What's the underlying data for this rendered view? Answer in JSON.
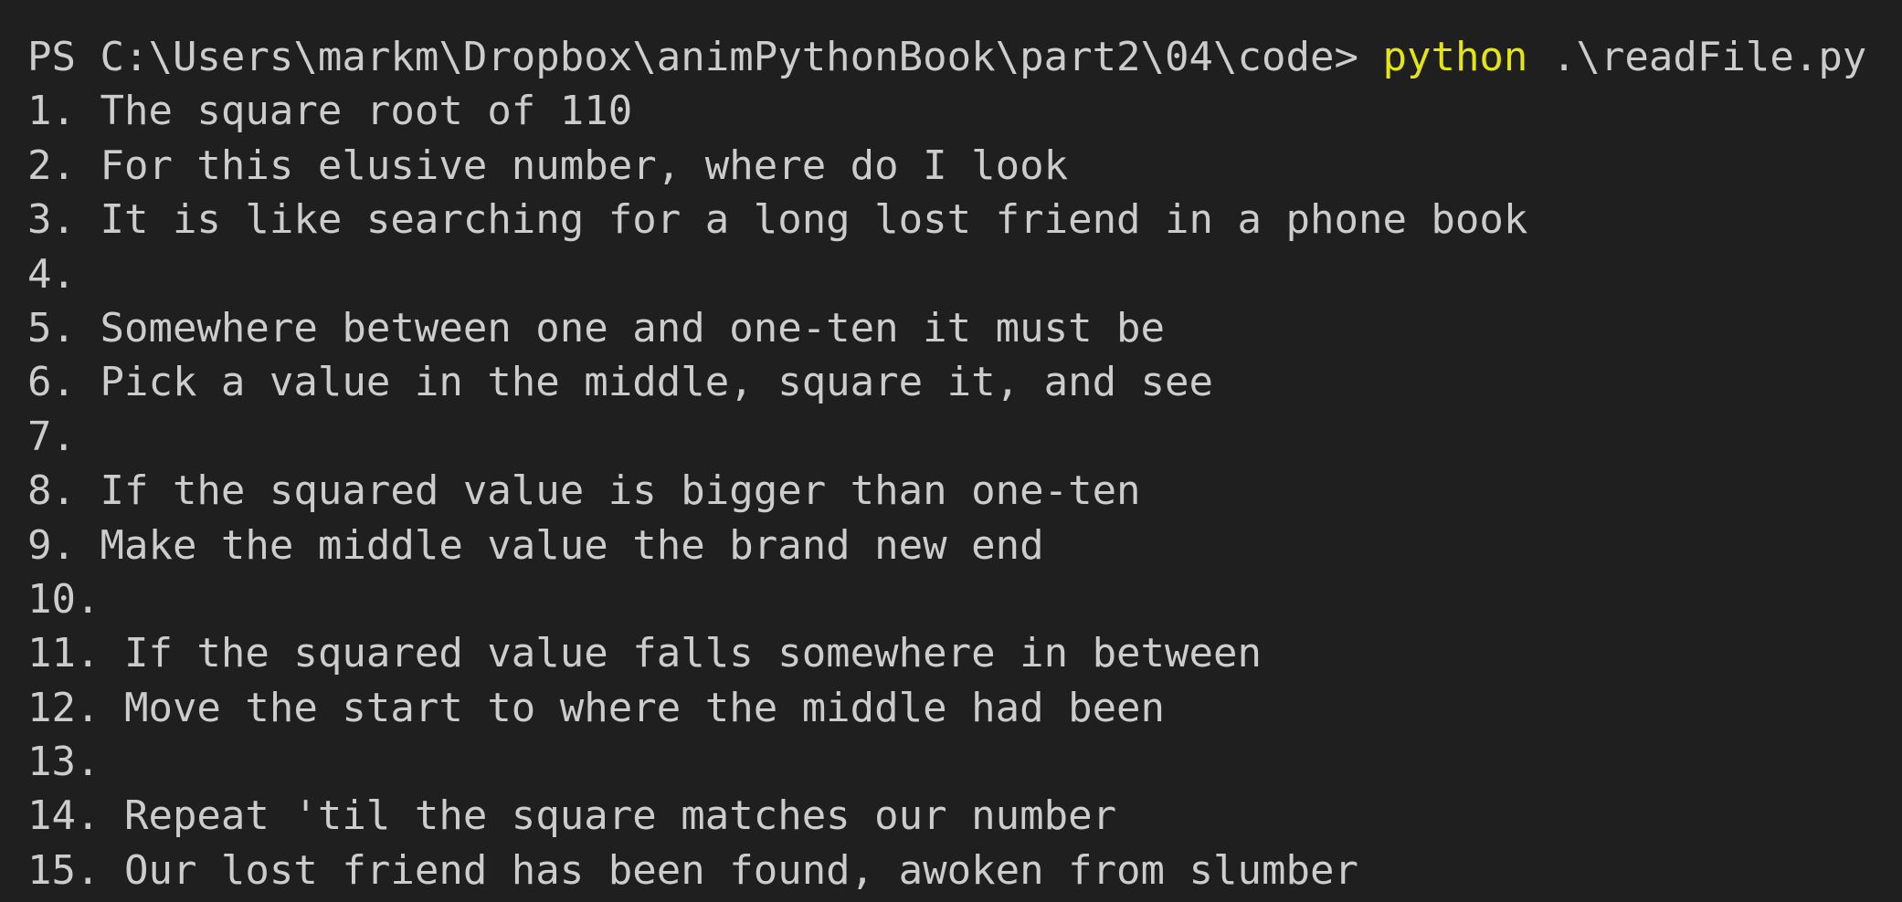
{
  "terminal": {
    "prompt": "PS C:\\Users\\markm\\Dropbox\\animPythonBook\\part2\\04\\code>",
    "command": "python",
    "argument": ".\\readFile.py",
    "output_lines": [
      "1. The square root of 110",
      "2. For this elusive number, where do I look",
      "3. It is like searching for a long lost friend in a phone book",
      "4.",
      "5. Somewhere between one and one-ten it must be",
      "6. Pick a value in the middle, square it, and see",
      "7.",
      "8. If the squared value is bigger than one-ten",
      "9. Make the middle value the brand new end",
      "10.",
      "11. If the squared value falls somewhere in between",
      "12. Move the start to where the middle had been",
      "13.",
      "14. Repeat 'til the square matches our number",
      "15. Our lost friend has been found, awoken from slumber"
    ]
  },
  "colors": {
    "background": "#1f1f1f",
    "text": "#cccccc",
    "command": "#e5e510"
  }
}
